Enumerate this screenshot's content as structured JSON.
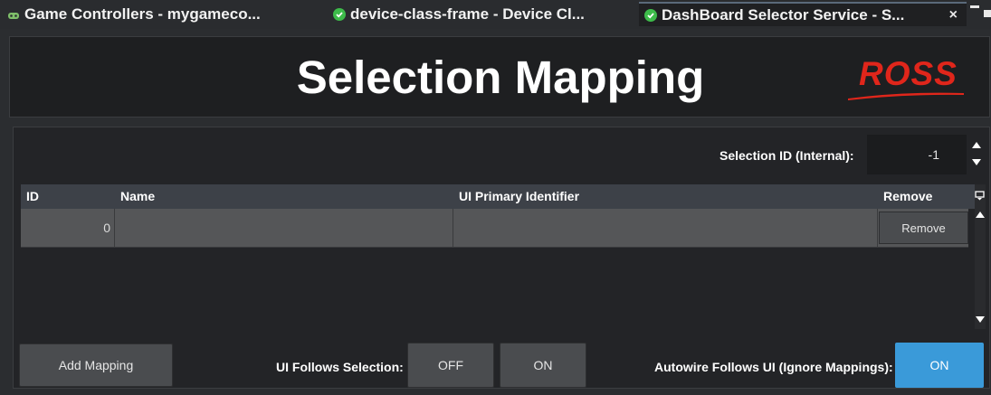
{
  "tabs": [
    {
      "label": "Game Controllers - mygameco...",
      "icon": "gamepad-icon"
    },
    {
      "label": "device-class-frame - Device Cl...",
      "icon": "check-icon"
    },
    {
      "label": "DashBoard Selector Service - S...",
      "icon": "check-icon",
      "active": true,
      "close_label": "×"
    }
  ],
  "header": {
    "title": "Selection Mapping",
    "logo_text": "ROSS",
    "logo_color": "#e0261b"
  },
  "selection": {
    "label": "Selection ID (Internal):",
    "value": "-1"
  },
  "table": {
    "columns": [
      "ID",
      "Name",
      "UI Primary Identifier",
      "Remove"
    ],
    "rows": [
      {
        "id": "0",
        "name": "",
        "ui_primary_identifier": "",
        "remove_label": "Remove"
      }
    ]
  },
  "controls": {
    "add_mapping_label": "Add Mapping",
    "ui_follows_label": "UI Follows Selection:",
    "off_label": "OFF",
    "on_label": "ON",
    "autowire_label": "Autowire Follows UI (Ignore Mappings):",
    "autowire_on_label": "ON",
    "active_color": "#3a9ad9"
  }
}
